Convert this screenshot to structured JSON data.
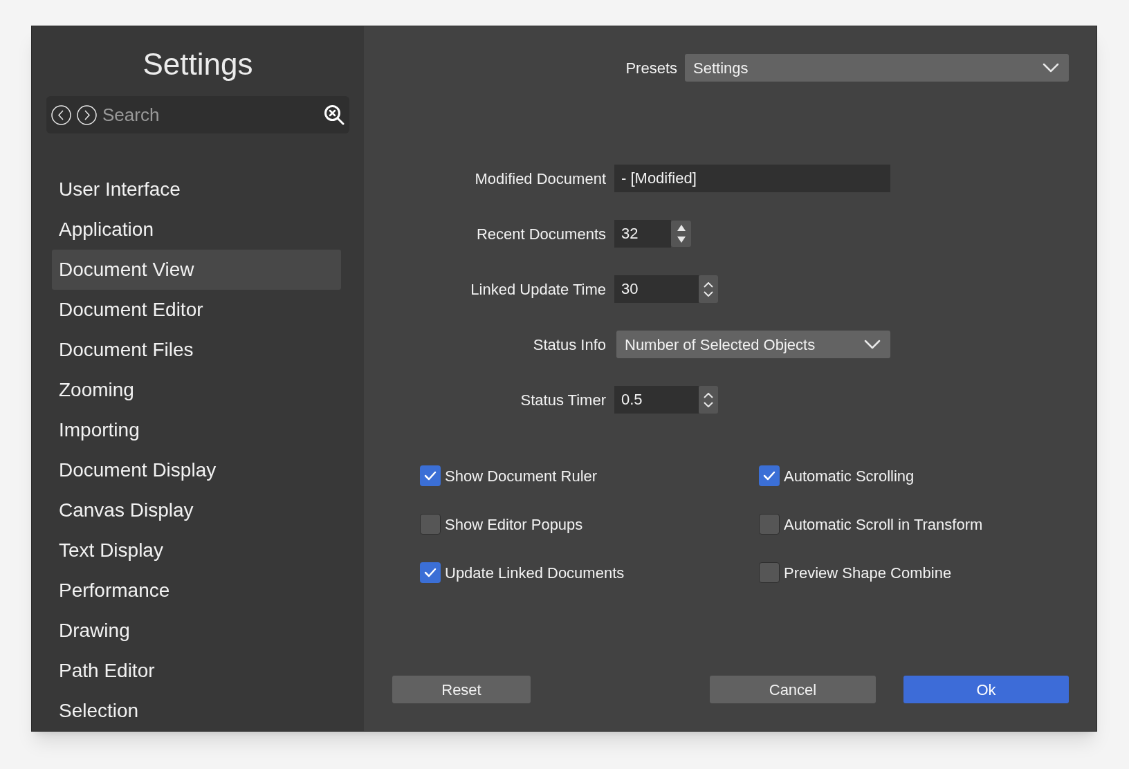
{
  "sidebar": {
    "title": "Settings",
    "search": {
      "placeholder": "Search"
    },
    "items": [
      {
        "label": "User Interface",
        "selected": false
      },
      {
        "label": "Application",
        "selected": false
      },
      {
        "label": "Document View",
        "selected": true
      },
      {
        "label": "Document Editor",
        "selected": false
      },
      {
        "label": "Document Files",
        "selected": false
      },
      {
        "label": "Zooming",
        "selected": false
      },
      {
        "label": "Importing",
        "selected": false
      },
      {
        "label": "Document Display",
        "selected": false
      },
      {
        "label": "Canvas Display",
        "selected": false
      },
      {
        "label": "Text Display",
        "selected": false
      },
      {
        "label": "Performance",
        "selected": false
      },
      {
        "label": "Drawing",
        "selected": false
      },
      {
        "label": "Path Editor",
        "selected": false
      },
      {
        "label": "Selection",
        "selected": false
      }
    ]
  },
  "presets": {
    "label": "Presets",
    "value": "Settings"
  },
  "fields": [
    {
      "kind": "text",
      "label": "Modified Document",
      "value": "- [Modified]"
    },
    {
      "kind": "stepper",
      "label": "Recent Documents",
      "value": "32"
    },
    {
      "kind": "spinner",
      "label": "Linked Update Time",
      "value": "30"
    },
    {
      "kind": "select",
      "label": "Status Info",
      "value": "Number of Selected Objects"
    },
    {
      "kind": "spinner",
      "label": "Status Timer",
      "value": "0.5"
    }
  ],
  "checkboxes": [
    {
      "label": "Show Document Ruler",
      "checked": true
    },
    {
      "label": "Automatic Scrolling",
      "checked": true
    },
    {
      "label": "Show Editor Popups",
      "checked": false
    },
    {
      "label": "Automatic Scroll in Transform",
      "checked": false
    },
    {
      "label": "Update Linked Documents",
      "checked": true
    },
    {
      "label": "Preview Shape Combine",
      "checked": false
    }
  ],
  "buttons": {
    "reset": "Reset",
    "cancel": "Cancel",
    "ok": "Ok"
  }
}
